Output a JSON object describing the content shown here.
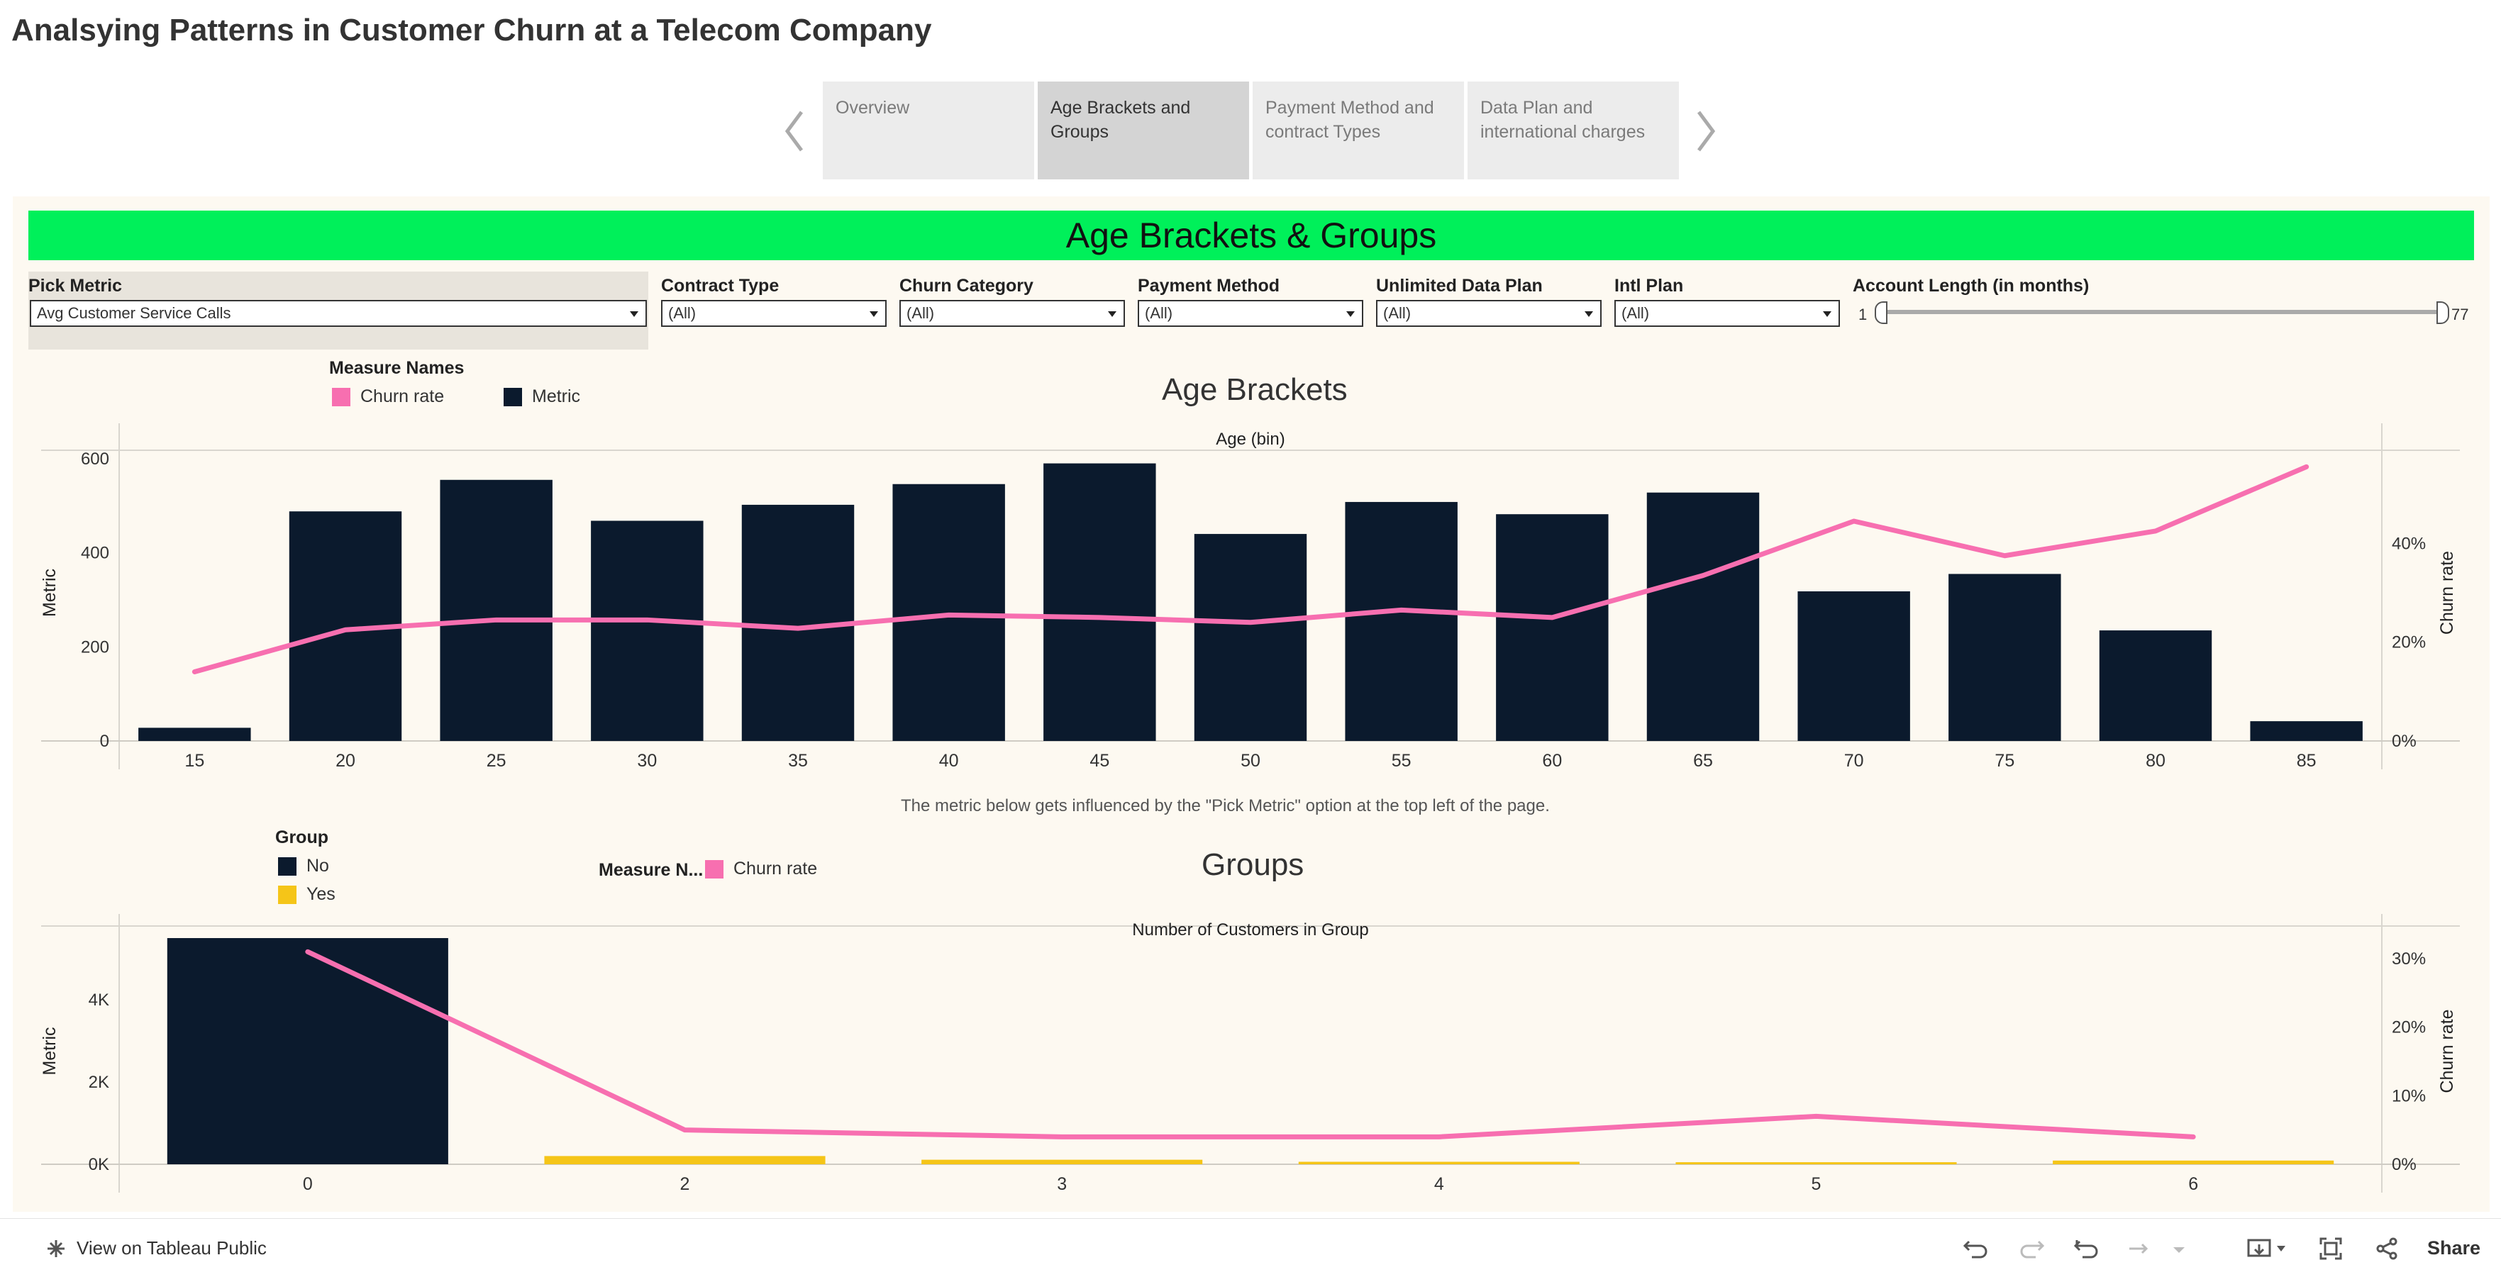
{
  "title": "Analsying Patterns in Customer Churn at a Telecom Company",
  "story_tabs": [
    {
      "label": "Overview"
    },
    {
      "label": "Age Brackets and Groups"
    },
    {
      "label": "Payment Method and contract Types"
    },
    {
      "label": "Data Plan and international charges"
    }
  ],
  "dashboard": {
    "banner": "Age Brackets & Groups",
    "filters": {
      "pick_metric": {
        "label": "Pick Metric",
        "value": "Avg Customer Service Calls"
      },
      "contract_type": {
        "label": "Contract Type",
        "value": "(All)"
      },
      "churn_category": {
        "label": "Churn Category",
        "value": "(All)"
      },
      "payment_method": {
        "label": "Payment Method",
        "value": "(All)"
      },
      "unlimited_data_plan": {
        "label": "Unlimited Data Plan",
        "value": "(All)"
      },
      "intl_plan": {
        "label": "Intl Plan",
        "value": "(All)"
      },
      "account_length": {
        "label": "Account Length (in months)",
        "min": "1",
        "max": "77"
      }
    },
    "legend1": {
      "title": "Measure Names",
      "items": [
        {
          "label": "Churn rate",
          "color": "#f76fb0"
        },
        {
          "label": "Metric",
          "color": "#0b1a2d"
        }
      ]
    },
    "legend2": {
      "title": "Group",
      "items": [
        {
          "label": "No",
          "color": "#0b1a2d"
        },
        {
          "label": "Yes",
          "color": "#f5c518"
        }
      ]
    },
    "legend3": {
      "title": "Measure N...",
      "items": [
        {
          "label": "Churn rate",
          "color": "#f76fb0"
        }
      ]
    },
    "note": "The metric below gets influenced by the \"Pick Metric\" option at the top left of the page."
  },
  "chart_data": [
    {
      "type": "bar",
      "title": "Age Brackets",
      "xlabel": "Age (bin)",
      "ylabel": "Metric",
      "y2label": "Churn rate",
      "categories": [
        "15",
        "20",
        "25",
        "30",
        "35",
        "40",
        "45",
        "50",
        "55",
        "60",
        "65",
        "70",
        "75",
        "80",
        "85"
      ],
      "series": [
        {
          "name": "Metric",
          "type": "bar",
          "color": "#0b1a2d",
          "values": [
            28,
            488,
            555,
            468,
            502,
            546,
            590,
            440,
            508,
            482,
            528,
            318,
            355,
            235,
            42
          ]
        },
        {
          "name": "Churn rate",
          "type": "line",
          "axis": "right",
          "color": "#f76fb0",
          "values": [
            0.14,
            0.225,
            0.245,
            0.245,
            0.228,
            0.255,
            0.25,
            0.24,
            0.265,
            0.25,
            0.335,
            0.445,
            0.375,
            0.425,
            0.555
          ]
        }
      ],
      "ylim": [
        0,
        630
      ],
      "yticks": [
        0,
        200,
        400,
        600
      ],
      "y2lim": [
        0,
        0.6
      ],
      "y2ticks": [
        0,
        0.2,
        0.4
      ],
      "y2ticklabels": [
        "0%",
        "20%",
        "40%"
      ]
    },
    {
      "type": "bar",
      "title": "Groups",
      "xlabel": "Number of Customers in Group",
      "ylabel": "Metric",
      "y2label": "Churn rate",
      "categories": [
        "0",
        "2",
        "3",
        "4",
        "5",
        "6"
      ],
      "series": [
        {
          "name": "Metric",
          "type": "bar",
          "values": [
            5500,
            200,
            110,
            60,
            50,
            90
          ],
          "groups": [
            "No",
            "Yes",
            "Yes",
            "Yes",
            "Yes",
            "Yes"
          ]
        },
        {
          "name": "Churn rate",
          "type": "line",
          "axis": "right",
          "color": "#f76fb0",
          "values": [
            0.31,
            0.05,
            0.04,
            0.04,
            0.07,
            0.04
          ]
        }
      ],
      "ylim": [
        0,
        5500
      ],
      "yticks": [
        0,
        2000,
        4000
      ],
      "yticklabels": [
        "0K",
        "2K",
        "4K"
      ],
      "y2lim": [
        0,
        0.33
      ],
      "y2ticks": [
        0,
        0.1,
        0.2,
        0.3
      ],
      "y2ticklabels": [
        "0%",
        "10%",
        "20%",
        "30%"
      ]
    }
  ],
  "footer": {
    "view_link": "View on Tableau Public",
    "share": "Share"
  }
}
